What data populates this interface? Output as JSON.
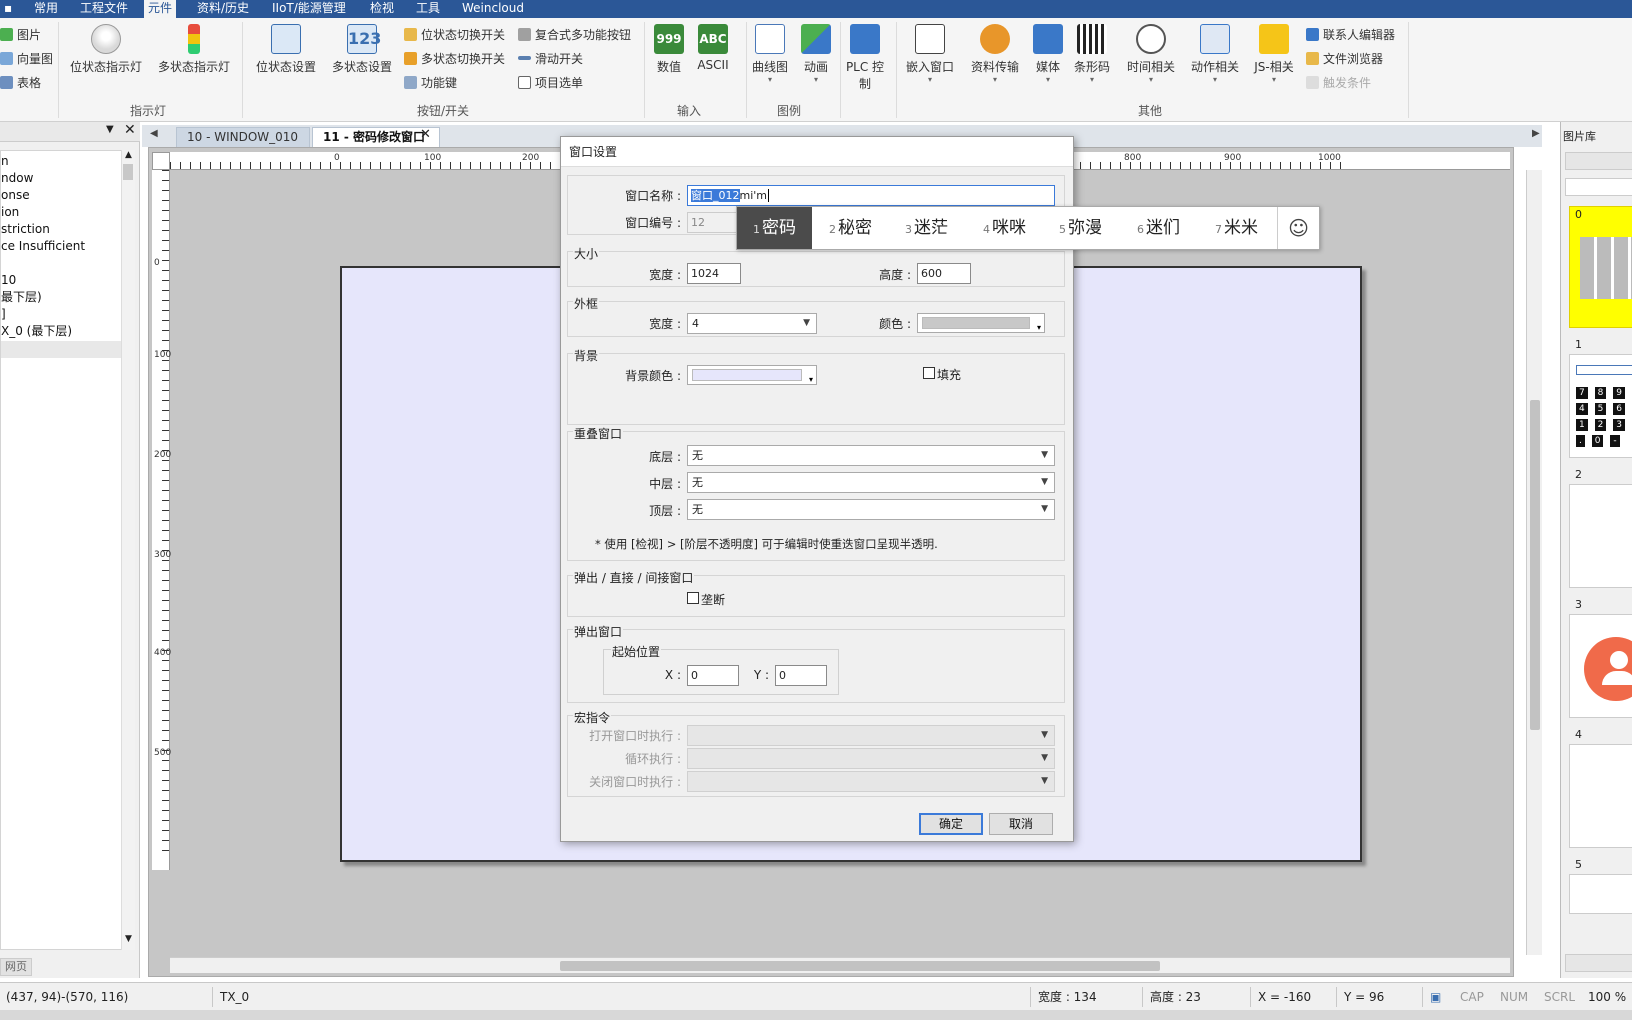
{
  "menu": {
    "items": [
      "常用",
      "工程文件",
      "元件",
      "资料/历史",
      "IIoT/能源管理",
      "检视",
      "工具",
      "Weincloud"
    ],
    "active": "元件"
  },
  "ribbon": {
    "left_small": [
      "图片",
      "向量图",
      "表格"
    ],
    "indicator": {
      "big": [
        "位状态指示灯",
        "多状态指示灯"
      ],
      "label": "指示灯"
    },
    "button_switch": {
      "big": [
        "位状态设置",
        "多状态设置"
      ],
      "small": [
        "位状态切换开关",
        "多状态切换开关",
        "功能键",
        "复合式多功能按钮",
        "滑动开关",
        "项目选单"
      ],
      "label": "按钮/开关"
    },
    "input": {
      "big": [
        "数值",
        "ASCII"
      ],
      "label": "输入",
      "numeric_icon_text": "999",
      "ascii_icon_text": "ABC"
    },
    "chart": {
      "big": [
        "曲线图",
        "动画"
      ],
      "label": "图例"
    },
    "plc": {
      "big": "PLC 控制"
    },
    "other": {
      "big": [
        "嵌入窗口",
        "资料传输",
        "媒体",
        "条形码",
        "时间相关",
        "动作相关",
        "JS-相关"
      ],
      "small": [
        "联系人编辑器",
        "文件浏览器",
        "触发条件"
      ],
      "label": "其他"
    }
  },
  "left_panel": {
    "tree": [
      "n",
      "ndow",
      "onse",
      "ion",
      "striction",
      "ce Insufficient",
      "",
      "10",
      "最下层)",
      "]",
      "X_0 (最下层)"
    ],
    "bottom_tab": "网页"
  },
  "tabs": [
    {
      "label": "10 - WINDOW_010",
      "active": false
    },
    {
      "label": "11 - 密码修改窗口",
      "active": true
    }
  ],
  "ruler": {
    "top": [
      "0",
      "100",
      "200",
      "800",
      "900",
      "1000"
    ],
    "left": [
      "0",
      "100",
      "200",
      "300",
      "400",
      "500"
    ]
  },
  "right_panel": {
    "title": "图片库",
    "thumbs": [
      "0",
      "1",
      "2",
      "3",
      "4",
      "5"
    ],
    "keypad_digits": [
      "7",
      "8",
      "9",
      "4",
      "5",
      "6",
      "1",
      "2",
      "3",
      ".",
      "0",
      "-"
    ]
  },
  "status": {
    "coords": "(437, 94)-(570, 116)",
    "object": "TX_0",
    "width": "宽度 : 134",
    "height": "高度 : 23",
    "x": "X = -160",
    "y": "Y = 96",
    "cap": "CAP",
    "num": "NUM",
    "scrl": "SCRL",
    "zoom": "100 %"
  },
  "dialog": {
    "title": "窗口设置",
    "name_label": "窗口名称 :",
    "name_value_selected": "窗口_012",
    "name_value_rest": "mi'm",
    "number_label": "窗口编号 :",
    "number_value": "12",
    "size": {
      "legend": "大小",
      "width_label": "宽度 :",
      "width": "1024",
      "height_label": "高度 :",
      "height": "600"
    },
    "frame": {
      "legend": "外框",
      "width_label": "宽度 :",
      "width": "4",
      "color_label": "颜色 :",
      "color": "#c8c8c8"
    },
    "background": {
      "legend": "背景",
      "color_label": "背景颜色 :",
      "color": "#e6e6fb",
      "fill_label": "填充",
      "fill_checked": false
    },
    "overlap": {
      "legend": "重叠窗口",
      "bottom_label": "底层 :",
      "bottom": "无",
      "middle_label": "中层 :",
      "middle": "无",
      "top_label": "顶层 :",
      "top": "无",
      "note": "* 使用 [检视] > [阶层不透明度] 可于编辑时使重迭窗口呈现半透明."
    },
    "popup_direct": {
      "legend": "弹出 / 直接 / 间接窗口",
      "interrupt_label": "垄断",
      "interrupt_checked": false
    },
    "popup": {
      "legend": "弹出窗口",
      "start_legend": "起始位置",
      "x_label": "X :",
      "x": "0",
      "y_label": "Y :",
      "y": "0"
    },
    "macro": {
      "legend": "宏指令",
      "open_label": "打开窗口时执行 :",
      "cycle_label": "循环执行 :",
      "close_label": "关闭窗口时执行 :"
    },
    "ok": "确定",
    "cancel": "取消"
  },
  "ime": {
    "candidates": [
      {
        "n": "1",
        "t": "密码"
      },
      {
        "n": "2",
        "t": "秘密"
      },
      {
        "n": "3",
        "t": "迷茫"
      },
      {
        "n": "4",
        "t": "咪咪"
      },
      {
        "n": "5",
        "t": "弥漫"
      },
      {
        "n": "6",
        "t": "迷们"
      },
      {
        "n": "7",
        "t": "米米"
      }
    ],
    "emoji": "☺"
  },
  "colors": {
    "menubar": "#2b5797",
    "canvas": "#e6e6fb",
    "accent": "#3b7ad9",
    "thumb_selected": "#ffff00"
  }
}
